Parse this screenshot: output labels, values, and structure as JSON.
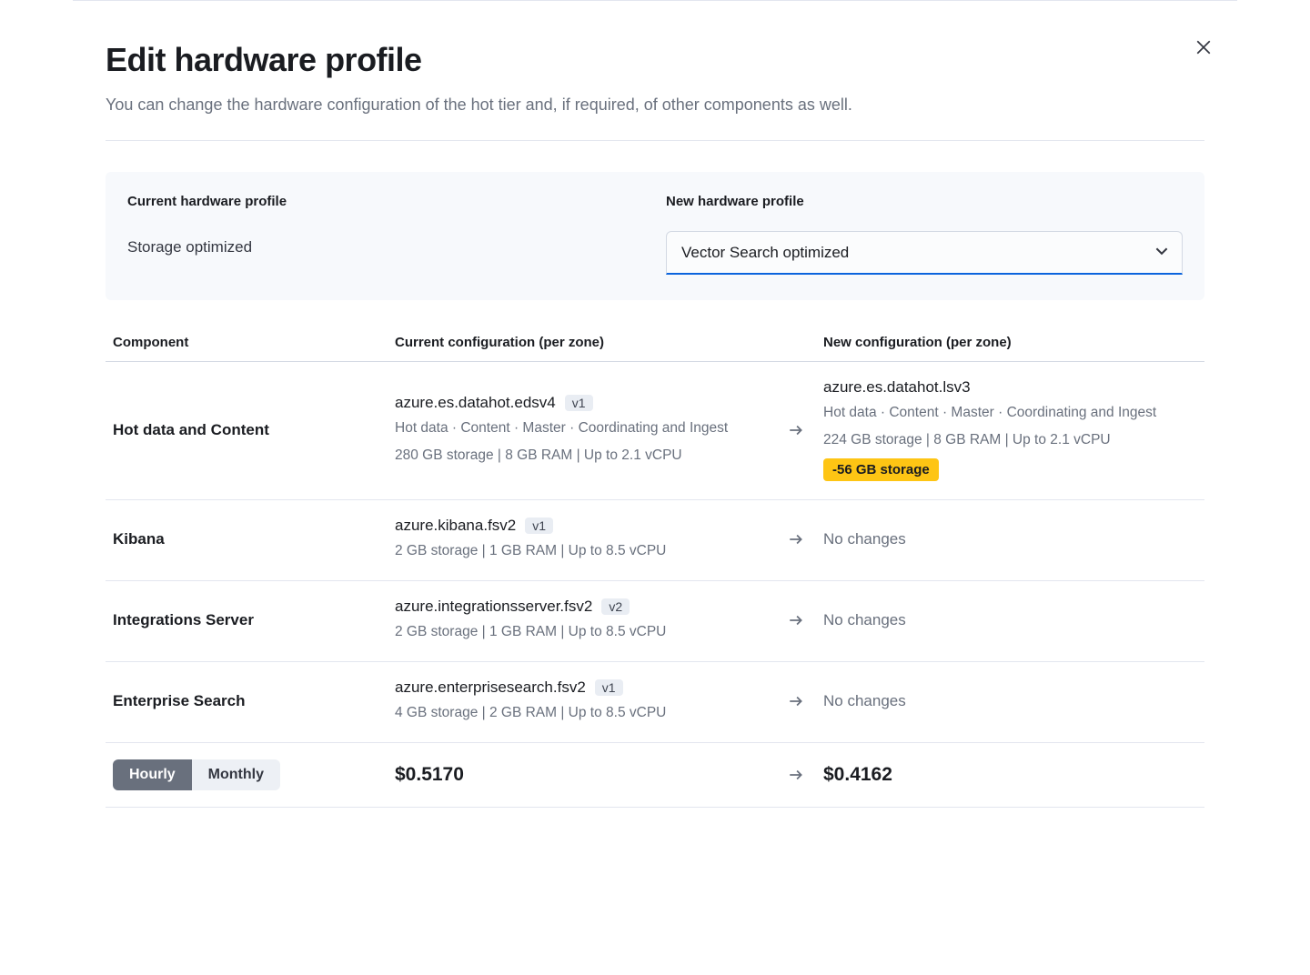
{
  "header": {
    "title": "Edit hardware profile",
    "subtitle": "You can change the hardware configuration of the hot tier and, if required, of other components as well."
  },
  "profile": {
    "current_label": "Current hardware profile",
    "current_value": "Storage optimized",
    "new_label": "New hardware profile",
    "new_value": "Vector Search optimized"
  },
  "table": {
    "headers": {
      "component": "Component",
      "current": "Current configuration (per zone)",
      "new": "New configuration (per zone)"
    },
    "rows": [
      {
        "name": "Hot data and Content",
        "current": {
          "instance": "azure.es.datahot.edsv4",
          "version": "v1",
          "roles": "Hot data · Content · Master · Coordinating and Ingest",
          "specs": "280 GB storage | 8 GB RAM | Up to 2.1 vCPU"
        },
        "new": {
          "instance": "azure.es.datahot.lsv3",
          "version": "",
          "roles": "Hot data · Content · Master · Coordinating and Ingest",
          "specs": "224 GB storage | 8 GB RAM | Up to 2.1 vCPU",
          "delta": "-56 GB storage"
        }
      },
      {
        "name": "Kibana",
        "current": {
          "instance": "azure.kibana.fsv2",
          "version": "v1",
          "roles": "",
          "specs": "2 GB storage | 1 GB RAM | Up to 8.5 vCPU"
        },
        "new": {
          "no_changes": "No changes"
        }
      },
      {
        "name": "Integrations Server",
        "current": {
          "instance": "azure.integrationsserver.fsv2",
          "version": "v2",
          "roles": "",
          "specs": "2 GB storage | 1 GB RAM | Up to 8.5 vCPU"
        },
        "new": {
          "no_changes": "No changes"
        }
      },
      {
        "name": "Enterprise Search",
        "current": {
          "instance": "azure.enterprisesearch.fsv2",
          "version": "v1",
          "roles": "",
          "specs": "4 GB storage | 2 GB RAM | Up to 8.5 vCPU"
        },
        "new": {
          "no_changes": "No changes"
        }
      }
    ],
    "footer": {
      "hourly": "Hourly",
      "monthly": "Monthly",
      "current_price": "$0.5170",
      "new_price": "$0.4162"
    }
  }
}
